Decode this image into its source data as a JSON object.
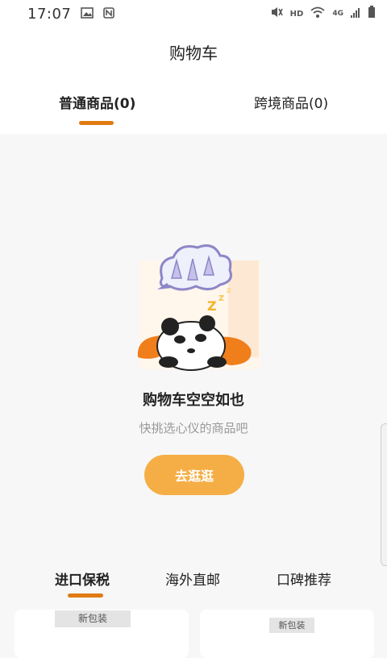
{
  "status_bar": {
    "time": "17:07",
    "hd": "HD",
    "network": "4G",
    "icons": [
      "image-icon",
      "nfc-icon",
      "vibrate-mute-icon",
      "wifi-icon",
      "signal-icon",
      "battery-icon"
    ]
  },
  "header": {
    "title": "购物车",
    "tabs": [
      {
        "label": "普通商品(0)",
        "active": true
      },
      {
        "label": "跨境商品(0)",
        "active": false
      }
    ]
  },
  "empty_state": {
    "title": "购物车空空如也",
    "subtitle": "快挑选心仪的商品吧",
    "button": "去逛逛"
  },
  "recommend": {
    "tabs": [
      {
        "label": "进口保税",
        "active": true
      },
      {
        "label": "海外直邮",
        "active": false
      },
      {
        "label": "口碑推荐",
        "active": false
      }
    ],
    "cards": [
      {
        "badge": "新包装"
      },
      {
        "badge": "新包装"
      }
    ]
  },
  "colors": {
    "accent": "#e07a12",
    "button": "#f5ae45",
    "background": "#f7f7f7"
  }
}
